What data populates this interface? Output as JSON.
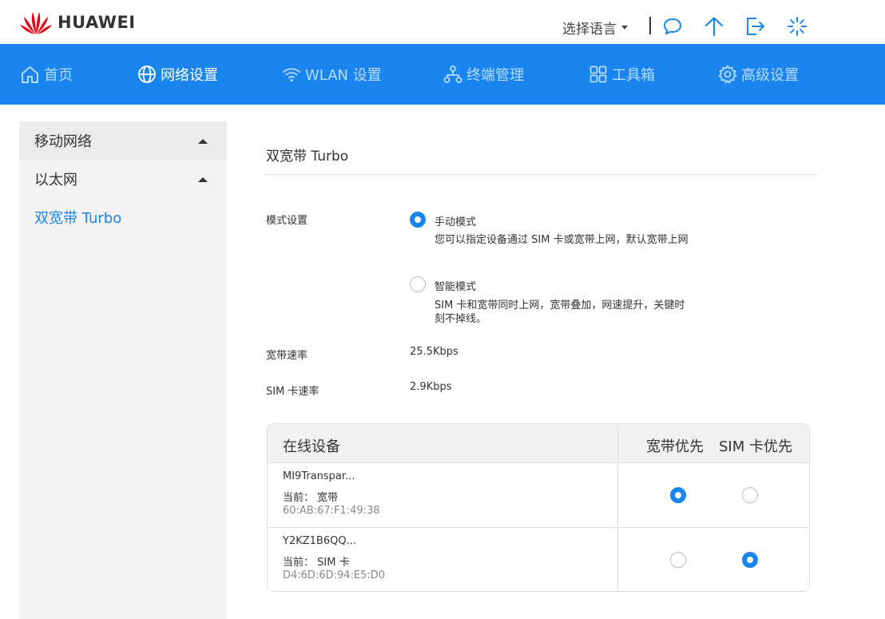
{
  "header": {
    "brand": "HUAWEI",
    "language_label": "选择语言"
  },
  "nav": {
    "items": [
      {
        "label": "首页",
        "icon": "home-icon"
      },
      {
        "label": "网络设置",
        "icon": "globe-icon",
        "active": true
      },
      {
        "label": "WLAN 设置",
        "icon": "wifi-icon"
      },
      {
        "label": "终端管理",
        "icon": "devices-icon"
      },
      {
        "label": "工具箱",
        "icon": "grid-icon"
      },
      {
        "label": "高级设置",
        "icon": "gear-icon"
      }
    ]
  },
  "sidebar": {
    "items": [
      {
        "label": "移动网络"
      },
      {
        "label": "以太网"
      },
      {
        "label": "双宽带 Turbo"
      }
    ]
  },
  "main": {
    "title": "双宽带 Turbo",
    "mode_label": "模式设置",
    "modes": [
      {
        "title": "手动模式",
        "desc": "您可以指定设备通过 SIM 卡或宽带上网，默认宽带上网",
        "selected": true
      },
      {
        "title": "智能模式",
        "desc": "SIM 卡和宽带同时上网，宽带叠加，网速提升，关键时刻不掉线。",
        "selected": false
      }
    ],
    "broadband_rate_label": "宽带速率",
    "broadband_rate_value": "25.5Kbps",
    "sim_rate_label": "SIM 卡速率",
    "sim_rate_value": "2.9Kbps"
  },
  "devices": {
    "headers": {
      "online": "在线设备",
      "broadband_first": "宽带优先",
      "sim_first": "SIM 卡优先"
    },
    "rows": [
      {
        "name": "MI9Transpar...",
        "current": "当前： 宽带",
        "mac": "60:AB:67:F1:49:38",
        "priority": "broadband"
      },
      {
        "name": "Y2KZ1B6QQ...",
        "current": "当前： SIM 卡",
        "mac": "D4:6D:6D:94:E5:D0",
        "priority": "sim"
      }
    ]
  },
  "colors": {
    "accent": "#1a85ef",
    "brand_red": "#e60012",
    "nav_inactive": "#b8dcff"
  }
}
